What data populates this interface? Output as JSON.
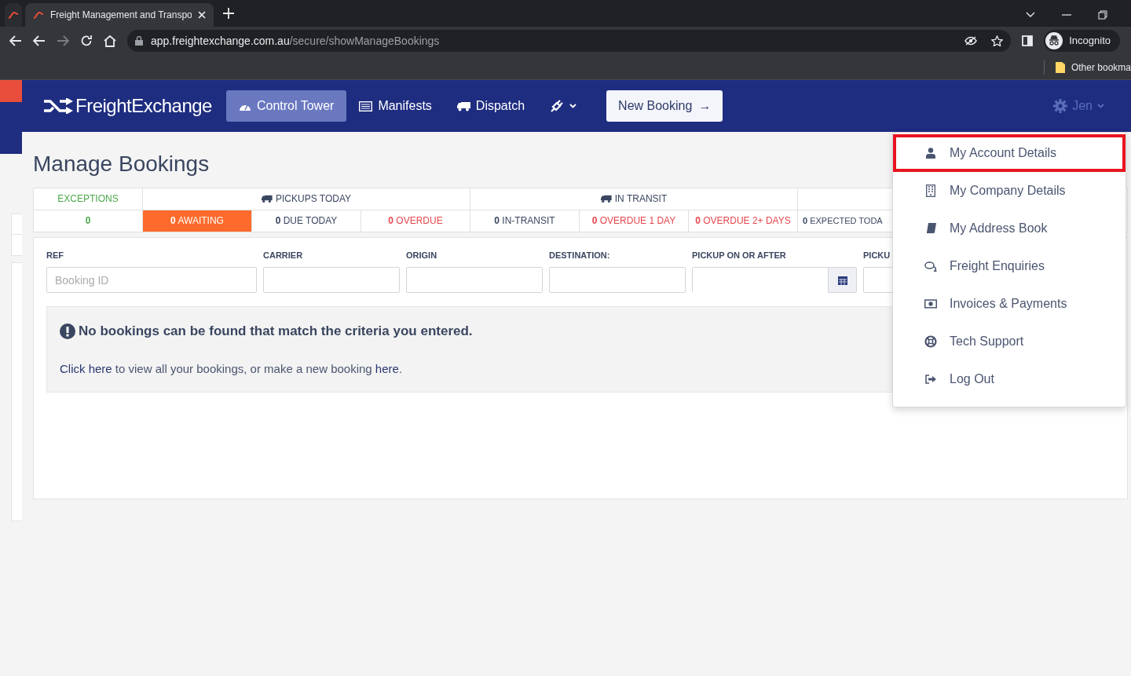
{
  "browser": {
    "tabs": [
      {
        "selected": false
      },
      {
        "title": "Freight Management and Transpo",
        "selected": true
      }
    ],
    "forward_disabled": true,
    "url_host": "app.freightexchange.com.au",
    "url_path": "/secure/showManageBookings",
    "profile": "Incognito",
    "bookmarks": [
      "Other bookma"
    ]
  },
  "navbar": {
    "brand": "FreightExchange",
    "items": [
      {
        "label": "Control Tower",
        "selected": true
      },
      {
        "label": "Manifests",
        "selected": false
      },
      {
        "label": "Dispatch",
        "selected": false
      },
      {
        "selected": false
      }
    ],
    "new_booking": {
      "label": "New Booking",
      "arrow": "→"
    },
    "user": {
      "name": "Jen",
      "menu_open": true
    }
  },
  "page": {
    "title": "Manage Bookings"
  },
  "stats": [
    {
      "label": "EXCEPTIONS",
      "color": "#4aa84a",
      "cells": [
        {
          "count": "0",
          "color": "#4aa84a",
          "selected": false
        }
      ]
    },
    {
      "label": "PICKUPS TODAY",
      "cells": [
        {
          "count": "0",
          "label": "AWAITING",
          "selected": true
        },
        {
          "count": "0",
          "label": "DUE TODAY",
          "selected": false
        },
        {
          "count": "0",
          "label": "OVERDUE",
          "color": "#e5484d",
          "selected": false
        }
      ]
    },
    {
      "label": "IN TRANSIT",
      "cells": [
        {
          "count": "0",
          "label": "IN-TRANSIT",
          "selected": false
        },
        {
          "count": "0",
          "label": "OVERDUE 1 DAY",
          "color": "#e5484d",
          "selected": false
        },
        {
          "count": "0",
          "label": "OVERDUE 2+ DAYS",
          "color": "#e5484d",
          "selected": false
        }
      ]
    },
    {
      "cells": [
        {
          "count": "0",
          "label": "EXPECTED TODA",
          "selected": false
        }
      ]
    }
  ],
  "filters": [
    {
      "label": "REF",
      "kind": "text",
      "placeholder": "Booking ID"
    },
    {
      "label": "CARRIER",
      "kind": "text"
    },
    {
      "label": "ORIGIN",
      "kind": "text"
    },
    {
      "label": "DESTINATION:",
      "kind": "text"
    },
    {
      "label": "PICKUP ON OR AFTER",
      "kind": "date"
    },
    {
      "label": "PICKU",
      "kind": "text"
    }
  ],
  "notice": {
    "heading": "No bookings can be found that match the criteria you entered.",
    "parts": [
      {
        "text": "Click here",
        "link": true
      },
      {
        "text": " to view all your bookings, or make a new booking"
      },
      {
        "text": " here",
        "link": true
      },
      {
        "text": "."
      }
    ]
  },
  "user_menu": [
    {
      "label": "My Account Details",
      "highlighted": true
    },
    {
      "label": "My Company Details",
      "highlighted": false
    },
    {
      "label": "My Address Book",
      "highlighted": false
    },
    {
      "label": "Freight Enquiries",
      "highlighted": false
    },
    {
      "label": "Invoices & Payments",
      "highlighted": false
    },
    {
      "label": "Tech Support",
      "highlighted": false
    },
    {
      "label": "Log Out",
      "highlighted": false
    }
  ]
}
